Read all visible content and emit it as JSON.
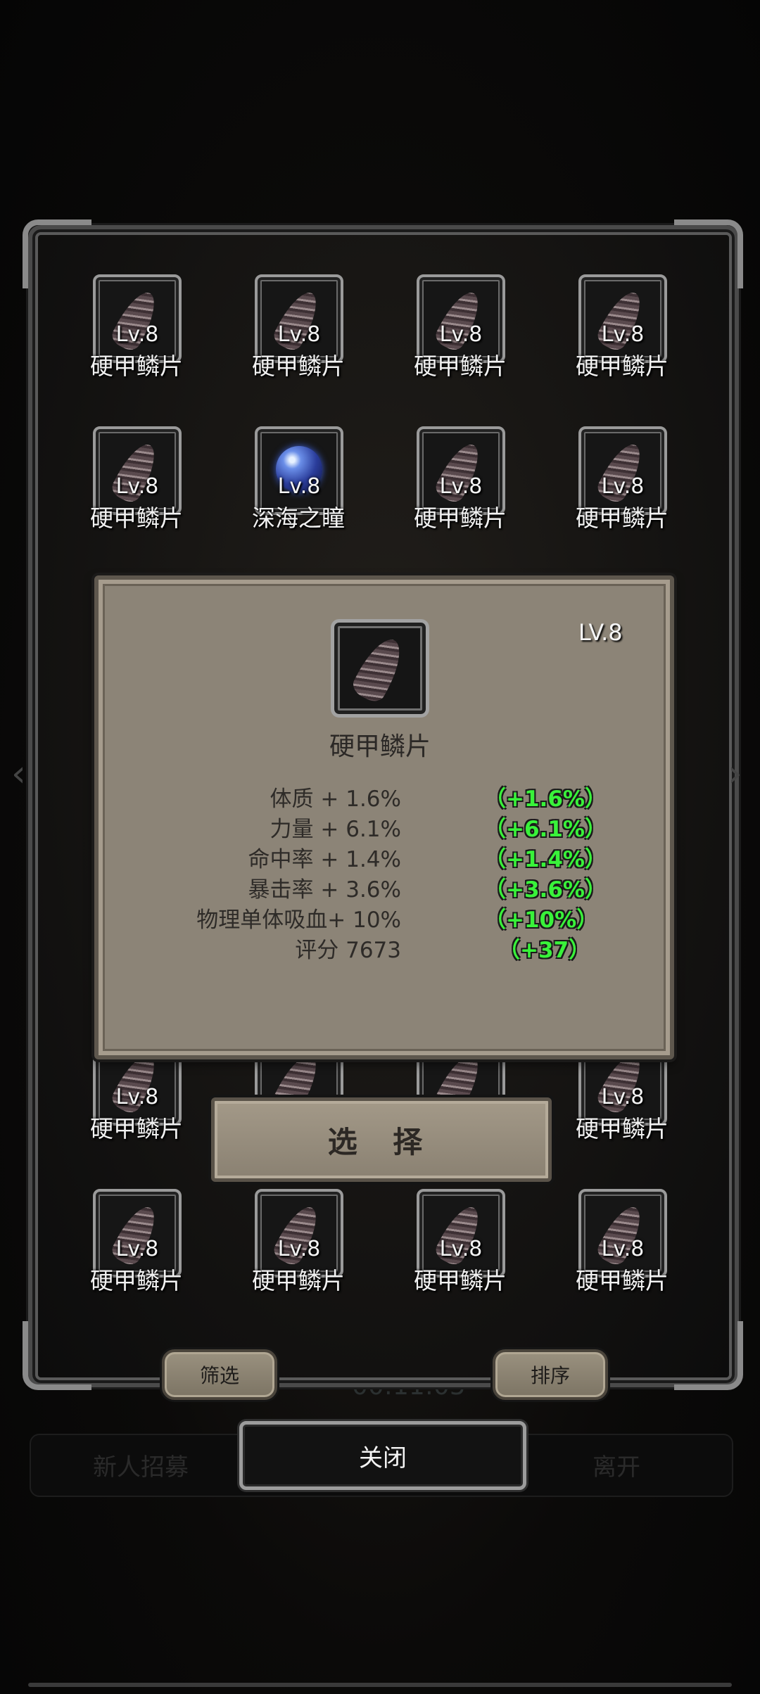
{
  "background": {
    "timer": "00:11:05",
    "left_bar_label": "新人招募",
    "right_bar_label": "离开"
  },
  "grid": {
    "rows": [
      [
        {
          "level": "Lv.8",
          "name": "硬甲鳞片",
          "icon": "scale-icon"
        },
        {
          "level": "Lv.8",
          "name": "硬甲鳞片",
          "icon": "scale-icon"
        },
        {
          "level": "Lv.8",
          "name": "硬甲鳞片",
          "icon": "scale-icon"
        },
        {
          "level": "Lv.8",
          "name": "硬甲鳞片",
          "icon": "scale-icon"
        }
      ],
      [
        {
          "level": "Lv.8",
          "name": "硬甲鳞片",
          "icon": "scale-icon"
        },
        {
          "level": "Lv.8",
          "name": "深海之瞳",
          "icon": "pearl-icon"
        },
        {
          "level": "Lv.8",
          "name": "硬甲鳞片",
          "icon": "scale-icon"
        },
        {
          "level": "Lv.8",
          "name": "硬甲鳞片",
          "icon": "scale-icon"
        }
      ],
      [
        {
          "level": "Lv.8",
          "name": "硬甲鳞片",
          "icon": "scale-icon"
        },
        {
          "level": "",
          "name": "",
          "icon": "scale-icon"
        },
        {
          "level": "",
          "name": "",
          "icon": "scale-icon"
        },
        {
          "level": "Lv.8",
          "name": "硬甲鳞片",
          "icon": "scale-icon"
        }
      ],
      [
        {
          "level": "Lv.8",
          "name": "硬甲鳞片",
          "icon": "scale-icon"
        },
        {
          "level": "Lv.8",
          "name": "硬甲鳞片",
          "icon": "scale-icon"
        },
        {
          "level": "Lv.8",
          "name": "硬甲鳞片",
          "icon": "scale-icon"
        },
        {
          "level": "Lv.8",
          "name": "硬甲鳞片",
          "icon": "scale-icon"
        }
      ]
    ]
  },
  "detail": {
    "level": "LV.8",
    "name": "硬甲鳞片",
    "icon": "scale-icon",
    "stats": [
      {
        "label": "体质 + 1.6%",
        "bonus": "（+1.6%）"
      },
      {
        "label": "力量 + 6.1%",
        "bonus": "（+6.1%）"
      },
      {
        "label": "命中率 + 1.4%",
        "bonus": "（+1.4%）"
      },
      {
        "label": "暴击率 + 3.6%",
        "bonus": "（+3.6%）"
      },
      {
        "label": "物理单体吸血+ 10%",
        "bonus": "（+10%）"
      },
      {
        "label": "评分 7673",
        "bonus": "（+37）"
      }
    ],
    "select_label": "选 择"
  },
  "buttons": {
    "filter": "筛选",
    "sort": "排序",
    "close": "关闭"
  },
  "colors": {
    "popup_bg": "#8c8477",
    "bonus_green": "#39f23a",
    "panel_border": "#8a8a8a"
  }
}
